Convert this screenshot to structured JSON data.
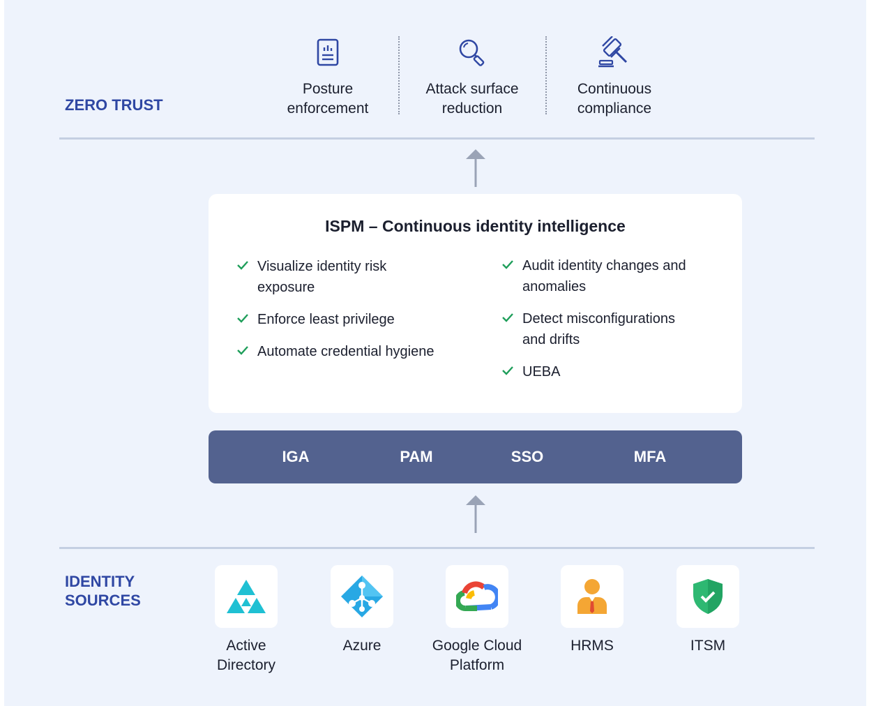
{
  "zero_trust": {
    "label_line1": "ZERO TRUST",
    "items": [
      {
        "line1": "Posture",
        "line2": "enforcement",
        "icon": "report-icon"
      },
      {
        "line1": "Attack surface",
        "line2": "reduction",
        "icon": "magnifier-icon"
      },
      {
        "line1": "Continuous",
        "line2": "compliance",
        "icon": "gavel-icon"
      }
    ]
  },
  "ispm": {
    "title": "ISPM – Continuous identity intelligence",
    "left_features": [
      {
        "line1": "Visualize identity risk",
        "line2": "exposure"
      },
      {
        "line1": "Enforce least privilege",
        "line2": ""
      },
      {
        "line1": "Automate credential hygiene",
        "line2": ""
      }
    ],
    "right_features": [
      {
        "line1": "Audit identity changes and",
        "line2": "anomalies"
      },
      {
        "line1": "Detect misconfigurations",
        "line2": "and drifts"
      },
      {
        "line1": "UEBA",
        "line2": ""
      }
    ]
  },
  "stack": [
    "IGA",
    "PAM",
    "SSO",
    "MFA"
  ],
  "identity_sources": {
    "label_line1": "IDENTITY",
    "label_line2": "SOURCES",
    "items": [
      {
        "line1": "Active",
        "line2": "Directory",
        "icon": "active-directory-icon"
      },
      {
        "line1": "Azure",
        "line2": "",
        "icon": "azure-icon"
      },
      {
        "line1": "Google Cloud",
        "line2": "Platform",
        "icon": "google-cloud-icon"
      },
      {
        "line1": "HRMS",
        "line2": "",
        "icon": "hrms-person-icon"
      },
      {
        "line1": "ITSM",
        "line2": "",
        "icon": "itsm-shield-icon"
      }
    ]
  },
  "colors": {
    "background": "#eef3fc",
    "label_blue": "#2f47a3",
    "bar": "#53628f",
    "check_green": "#1e9e5a",
    "arrow": "#9aa3b6"
  }
}
